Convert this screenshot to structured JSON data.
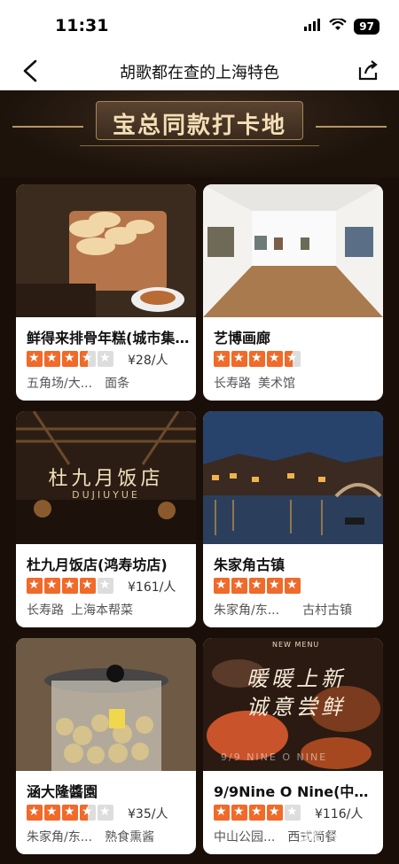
{
  "status": {
    "time": "11:31",
    "battery": "97"
  },
  "nav": {
    "title": "胡歌都在查的上海特色"
  },
  "hero": {
    "title": "宝总同款打卡地"
  },
  "cards": [
    {
      "name": "鲜得来排骨年糕(城市集...",
      "rating": 3.5,
      "price": "¥28/人",
      "area": "五角场/大...",
      "category": "面条"
    },
    {
      "name": "艺博画廊",
      "rating": 4.5,
      "price": "",
      "area": "长寿路",
      "category": "美术馆"
    },
    {
      "name": "杜九月饭店(鸿寿坊店)",
      "rating": 4,
      "price": "¥161/人",
      "area": "长寿路",
      "category": "上海本帮菜"
    },
    {
      "name": "朱家角古镇",
      "rating": 5,
      "price": "",
      "area": "朱家角/东...",
      "category": "古村古镇"
    },
    {
      "name": "涵大隆醬園",
      "rating": 3.5,
      "price": "¥35/人",
      "area": "朱家角/东...",
      "category": "熟食熏酱"
    },
    {
      "name": "9/9Nine O Nine(中山...",
      "rating": 4,
      "price": "¥116/人",
      "area": "中山公园...",
      "category": "西式简餐"
    }
  ],
  "photos": {
    "card1_overlay": "",
    "card3_logo_cn": "杜九月饭店",
    "card3_logo_en": "DUJIUYUE",
    "card6_overlay_cn": "暖暖上新 诚意尝鲜",
    "card6_overlay_en": "9/9 NINE O NINE",
    "card6_badge": "NEW MENU"
  },
  "watermark": "苔水网"
}
